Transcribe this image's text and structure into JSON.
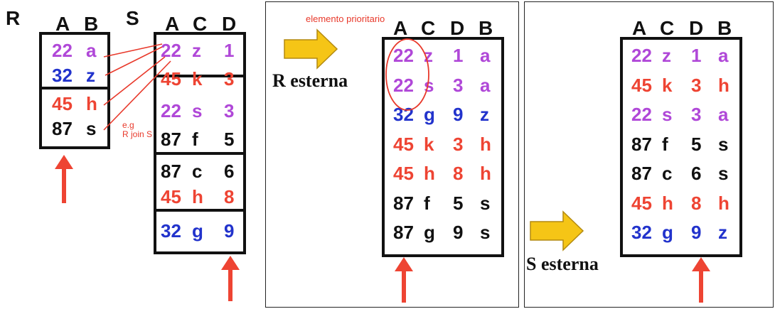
{
  "colors": {
    "purple": "#b048d8",
    "blue": "#2233cc",
    "red": "#ee4433",
    "black": "#111111",
    "arrow": "#ee4433",
    "yellow_arrow": "#f5c516",
    "yellow_arrow_edge": "#b38a10"
  },
  "left": {
    "title_r": "R",
    "title_s": "S",
    "r_headers": [
      "A",
      "B"
    ],
    "r_rows": [
      [
        "22",
        "a",
        "purple"
      ],
      [
        "32",
        "z",
        "blue"
      ],
      [
        "45",
        "h",
        "red"
      ],
      [
        "87",
        "s",
        "black"
      ]
    ],
    "s_headers": [
      "A",
      "C",
      "D"
    ],
    "s_rows": [
      [
        "22",
        "z",
        "1",
        "purple"
      ],
      [
        "45",
        "k",
        "3",
        "red"
      ],
      [
        "22",
        "s",
        "3",
        "purple"
      ],
      [
        "87",
        "f",
        "5",
        "black"
      ],
      [
        "87",
        "c",
        "6",
        "black"
      ],
      [
        "45",
        "h",
        "8",
        "red"
      ],
      [
        "32",
        "g",
        "9",
        "blue"
      ]
    ],
    "note_line1": "e.g",
    "note_line2": "R join S"
  },
  "middle": {
    "label": "R esterna",
    "note": "elemento prioritario",
    "headers": [
      "A",
      "C",
      "D",
      "B"
    ],
    "rows": [
      [
        "22",
        "z",
        "1",
        "a",
        "purple"
      ],
      [
        "22",
        "s",
        "3",
        "a",
        "purple"
      ],
      [
        "32",
        "g",
        "9",
        "z",
        "blue"
      ],
      [
        "45",
        "k",
        "3",
        "h",
        "red"
      ],
      [
        "45",
        "h",
        "8",
        "h",
        "red"
      ],
      [
        "87",
        "f",
        "5",
        "s",
        "black"
      ],
      [
        "87",
        "g",
        "9",
        "s",
        "black"
      ]
    ]
  },
  "right": {
    "label": "S esterna",
    "headers": [
      "A",
      "C",
      "D",
      "B"
    ],
    "rows": [
      [
        "22",
        "z",
        "1",
        "a",
        "purple"
      ],
      [
        "45",
        "k",
        "3",
        "h",
        "red"
      ],
      [
        "22",
        "s",
        "3",
        "a",
        "purple"
      ],
      [
        "87",
        "f",
        "5",
        "s",
        "black"
      ],
      [
        "87",
        "c",
        "6",
        "s",
        "black"
      ],
      [
        "45",
        "h",
        "8",
        "h",
        "red"
      ],
      [
        "32",
        "g",
        "9",
        "z",
        "blue"
      ]
    ]
  }
}
